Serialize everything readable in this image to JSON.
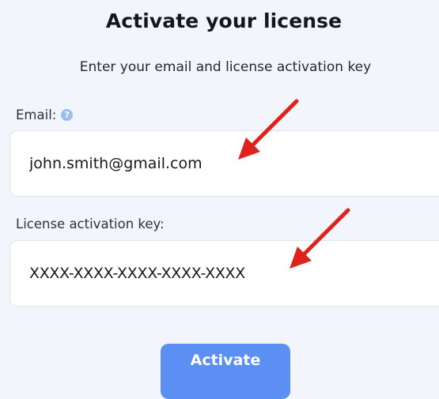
{
  "heading": {
    "title": "Activate your license",
    "subtitle": "Enter your email and license activation key"
  },
  "form": {
    "email": {
      "label": "Email:",
      "help_icon": "?",
      "value": "john.smith@gmail.com"
    },
    "license_key": {
      "label": "License activation key:",
      "value": "XXXX-XXXX-XXXX-XXXX-XXXX"
    },
    "submit_label": "Activate"
  },
  "icons": {
    "help": "question-circle-icon",
    "annotation": "red-arrow-icon"
  },
  "colors": {
    "background": "#f2f5fb",
    "accent": "#5c8ff3",
    "help_icon": "#9dbcee",
    "annotation_arrow": "#e0221c"
  }
}
